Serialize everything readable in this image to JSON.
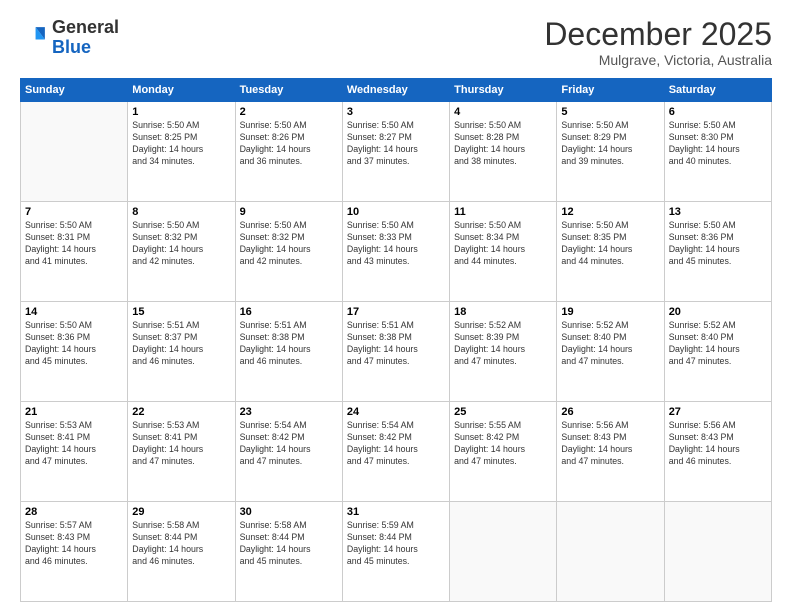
{
  "header": {
    "logo_general": "General",
    "logo_blue": "Blue",
    "month": "December 2025",
    "location": "Mulgrave, Victoria, Australia"
  },
  "weekdays": [
    "Sunday",
    "Monday",
    "Tuesday",
    "Wednesday",
    "Thursday",
    "Friday",
    "Saturday"
  ],
  "weeks": [
    [
      {
        "day": "",
        "info": ""
      },
      {
        "day": "1",
        "info": "Sunrise: 5:50 AM\nSunset: 8:25 PM\nDaylight: 14 hours\nand 34 minutes."
      },
      {
        "day": "2",
        "info": "Sunrise: 5:50 AM\nSunset: 8:26 PM\nDaylight: 14 hours\nand 36 minutes."
      },
      {
        "day": "3",
        "info": "Sunrise: 5:50 AM\nSunset: 8:27 PM\nDaylight: 14 hours\nand 37 minutes."
      },
      {
        "day": "4",
        "info": "Sunrise: 5:50 AM\nSunset: 8:28 PM\nDaylight: 14 hours\nand 38 minutes."
      },
      {
        "day": "5",
        "info": "Sunrise: 5:50 AM\nSunset: 8:29 PM\nDaylight: 14 hours\nand 39 minutes."
      },
      {
        "day": "6",
        "info": "Sunrise: 5:50 AM\nSunset: 8:30 PM\nDaylight: 14 hours\nand 40 minutes."
      }
    ],
    [
      {
        "day": "7",
        "info": "Sunrise: 5:50 AM\nSunset: 8:31 PM\nDaylight: 14 hours\nand 41 minutes."
      },
      {
        "day": "8",
        "info": "Sunrise: 5:50 AM\nSunset: 8:32 PM\nDaylight: 14 hours\nand 42 minutes."
      },
      {
        "day": "9",
        "info": "Sunrise: 5:50 AM\nSunset: 8:32 PM\nDaylight: 14 hours\nand 42 minutes."
      },
      {
        "day": "10",
        "info": "Sunrise: 5:50 AM\nSunset: 8:33 PM\nDaylight: 14 hours\nand 43 minutes."
      },
      {
        "day": "11",
        "info": "Sunrise: 5:50 AM\nSunset: 8:34 PM\nDaylight: 14 hours\nand 44 minutes."
      },
      {
        "day": "12",
        "info": "Sunrise: 5:50 AM\nSunset: 8:35 PM\nDaylight: 14 hours\nand 44 minutes."
      },
      {
        "day": "13",
        "info": "Sunrise: 5:50 AM\nSunset: 8:36 PM\nDaylight: 14 hours\nand 45 minutes."
      }
    ],
    [
      {
        "day": "14",
        "info": "Sunrise: 5:50 AM\nSunset: 8:36 PM\nDaylight: 14 hours\nand 45 minutes."
      },
      {
        "day": "15",
        "info": "Sunrise: 5:51 AM\nSunset: 8:37 PM\nDaylight: 14 hours\nand 46 minutes."
      },
      {
        "day": "16",
        "info": "Sunrise: 5:51 AM\nSunset: 8:38 PM\nDaylight: 14 hours\nand 46 minutes."
      },
      {
        "day": "17",
        "info": "Sunrise: 5:51 AM\nSunset: 8:38 PM\nDaylight: 14 hours\nand 47 minutes."
      },
      {
        "day": "18",
        "info": "Sunrise: 5:52 AM\nSunset: 8:39 PM\nDaylight: 14 hours\nand 47 minutes."
      },
      {
        "day": "19",
        "info": "Sunrise: 5:52 AM\nSunset: 8:40 PM\nDaylight: 14 hours\nand 47 minutes."
      },
      {
        "day": "20",
        "info": "Sunrise: 5:52 AM\nSunset: 8:40 PM\nDaylight: 14 hours\nand 47 minutes."
      }
    ],
    [
      {
        "day": "21",
        "info": "Sunrise: 5:53 AM\nSunset: 8:41 PM\nDaylight: 14 hours\nand 47 minutes."
      },
      {
        "day": "22",
        "info": "Sunrise: 5:53 AM\nSunset: 8:41 PM\nDaylight: 14 hours\nand 47 minutes."
      },
      {
        "day": "23",
        "info": "Sunrise: 5:54 AM\nSunset: 8:42 PM\nDaylight: 14 hours\nand 47 minutes."
      },
      {
        "day": "24",
        "info": "Sunrise: 5:54 AM\nSunset: 8:42 PM\nDaylight: 14 hours\nand 47 minutes."
      },
      {
        "day": "25",
        "info": "Sunrise: 5:55 AM\nSunset: 8:42 PM\nDaylight: 14 hours\nand 47 minutes."
      },
      {
        "day": "26",
        "info": "Sunrise: 5:56 AM\nSunset: 8:43 PM\nDaylight: 14 hours\nand 47 minutes."
      },
      {
        "day": "27",
        "info": "Sunrise: 5:56 AM\nSunset: 8:43 PM\nDaylight: 14 hours\nand 46 minutes."
      }
    ],
    [
      {
        "day": "28",
        "info": "Sunrise: 5:57 AM\nSunset: 8:43 PM\nDaylight: 14 hours\nand 46 minutes."
      },
      {
        "day": "29",
        "info": "Sunrise: 5:58 AM\nSunset: 8:44 PM\nDaylight: 14 hours\nand 46 minutes."
      },
      {
        "day": "30",
        "info": "Sunrise: 5:58 AM\nSunset: 8:44 PM\nDaylight: 14 hours\nand 45 minutes."
      },
      {
        "day": "31",
        "info": "Sunrise: 5:59 AM\nSunset: 8:44 PM\nDaylight: 14 hours\nand 45 minutes."
      },
      {
        "day": "",
        "info": ""
      },
      {
        "day": "",
        "info": ""
      },
      {
        "day": "",
        "info": ""
      }
    ]
  ]
}
